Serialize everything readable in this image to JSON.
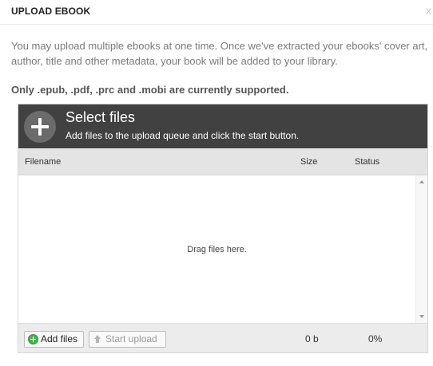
{
  "dialog": {
    "title": "UPLOAD EBOOK",
    "close_label": "x",
    "intro": "You may upload multiple ebooks at one time. Once we've extracted your ebooks' cover art, author, title and other metadata, your book will be added to your library.",
    "supported": "Only .epub, .pdf, .prc and .mobi are currently supported."
  },
  "uploader": {
    "head_icon": "plus-icon",
    "head_title": "Select files",
    "head_subtitle": "Add files to the upload queue and click the start button.",
    "columns": [
      "Filename",
      "Size",
      "Status"
    ],
    "drop_text": "Drag files here.",
    "add_files_label": "Add files",
    "add_files_icon": "add-icon",
    "start_upload_label": "Start upload",
    "start_upload_icon": "upload-arrow-icon",
    "total_size": "0 b",
    "total_percent": "0%"
  }
}
